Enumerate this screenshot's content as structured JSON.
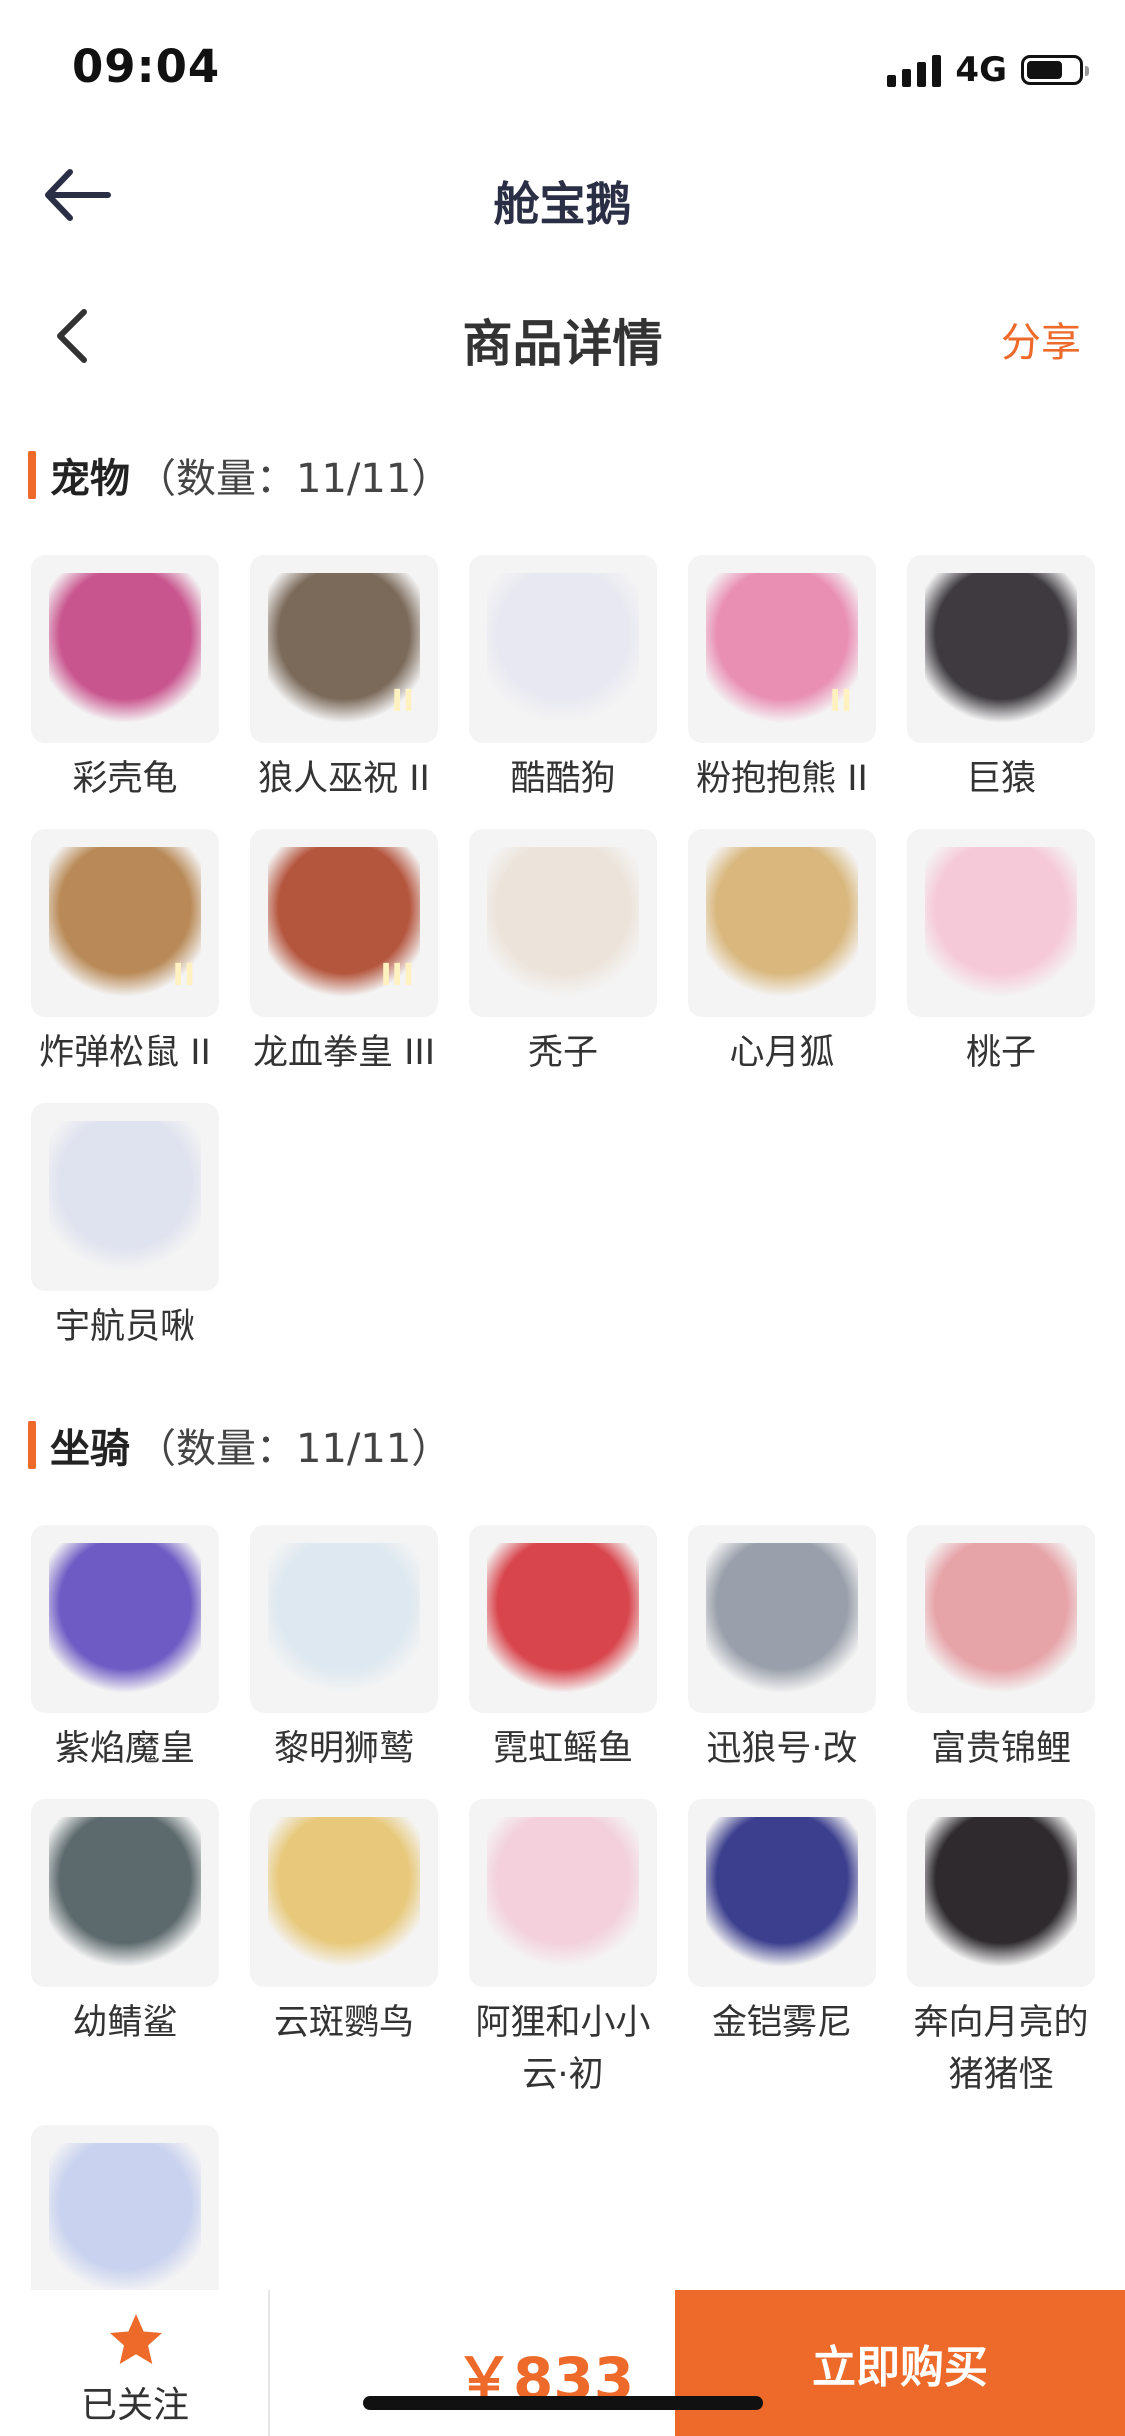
{
  "status_bar": {
    "time": "09:04",
    "network": "4G"
  },
  "app_bar": {
    "title": "舱宝鹅"
  },
  "page_bar": {
    "title": "商品详情",
    "share": "分享"
  },
  "pets_section": {
    "name": "宠物",
    "count": "（数量：11/11）",
    "items": [
      {
        "label": "彩壳龟",
        "color": "#c9558e",
        "badge": ""
      },
      {
        "label": "狼人巫祝 II",
        "color": "#7b6a5a",
        "badge": "II"
      },
      {
        "label": "酷酷狗",
        "color": "#e8e8f2",
        "badge": ""
      },
      {
        "label": "粉抱抱熊 II",
        "color": "#e98fb4",
        "badge": "II"
      },
      {
        "label": "巨猿",
        "color": "#3e3a40",
        "badge": ""
      },
      {
        "label": "炸弹松鼠 II",
        "color": "#b98a57",
        "badge": "II"
      },
      {
        "label": "龙血拳皇 III",
        "color": "#b4553d",
        "badge": "III"
      },
      {
        "label": "秃子",
        "color": "#ece3da",
        "badge": ""
      },
      {
        "label": "心月狐",
        "color": "#d9b77d",
        "badge": ""
      },
      {
        "label": "桃子",
        "color": "#f6c9d8",
        "badge": ""
      },
      {
        "label": "宇航员啾",
        "color": "#dfe2ef",
        "badge": ""
      }
    ]
  },
  "mounts_section": {
    "name": "坐骑",
    "count": "（数量：11/11）",
    "items": [
      {
        "label": "紫焰魔皇",
        "color": "#6f5bc4"
      },
      {
        "label": "黎明狮鹫",
        "color": "#dde8f0"
      },
      {
        "label": "霓虹鳐鱼",
        "color": "#d8454c"
      },
      {
        "label": "迅狼号·改",
        "color": "#9aa0ab"
      },
      {
        "label": "富贵锦鲤",
        "color": "#e6a3a8"
      },
      {
        "label": "幼鲭鲨",
        "color": "#5d6a6d"
      },
      {
        "label": "云斑鹦鸟",
        "color": "#e8c97c"
      },
      {
        "label": "阿狸和小小云·初",
        "color": "#f3d0dc"
      },
      {
        "label": "金铠雾尼",
        "color": "#3c3f8e"
      },
      {
        "label": "奔向月亮的猪猪怪",
        "color": "#2e2a2e"
      },
      {
        "label": "",
        "color": "#c9d2ef"
      }
    ]
  },
  "bottom_bar": {
    "follow_label": "已关注",
    "price": "￥833",
    "buy_label": "立即购买"
  },
  "colors": {
    "accent": "#ee6a2a"
  }
}
